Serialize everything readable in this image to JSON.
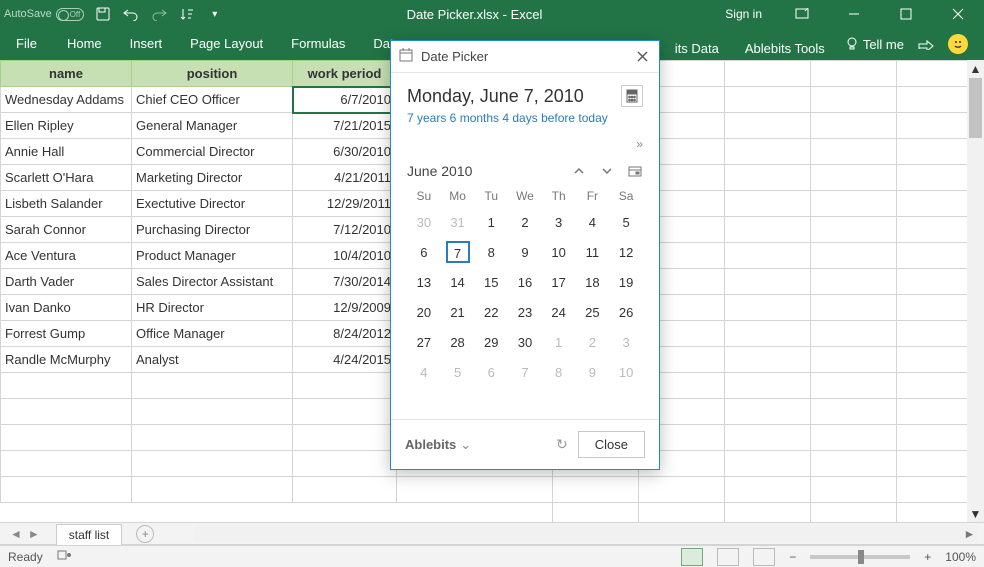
{
  "titlebar": {
    "autosave_label": "AutoSave",
    "autosave_off": "Off",
    "title": "Date Picker.xlsx - Excel",
    "signin": "Sign in"
  },
  "ribbon": {
    "file": "File",
    "tabs": [
      "Home",
      "Insert",
      "Page Layout",
      "Formulas",
      "Data"
    ],
    "right_partial": "its Data",
    "ablebits_tools": "Ablebits Tools",
    "tellme": "Tell me"
  },
  "sheet": {
    "headers": {
      "name": "name",
      "position": "position",
      "period": "work period"
    },
    "rows": [
      {
        "name": "Wednesday Addams",
        "position": "Chief CEO Officer",
        "period": "6/7/2010"
      },
      {
        "name": "Ellen Ripley",
        "position": "General Manager",
        "period": "7/21/2015"
      },
      {
        "name": "Annie Hall",
        "position": "Commercial Director",
        "period": "6/30/2010"
      },
      {
        "name": "Scarlett O'Hara",
        "position": "Marketing Director",
        "period": "4/21/2011"
      },
      {
        "name": "Lisbeth Salander",
        "position": "Exectutive Director",
        "period": "12/29/2011"
      },
      {
        "name": "Sarah Connor",
        "position": "Purchasing Director",
        "period": "7/12/2010"
      },
      {
        "name": "Ace Ventura",
        "position": "Product Manager",
        "period": "10/4/2010"
      },
      {
        "name": "Darth Vader",
        "position": "Sales Director Assistant",
        "period": "7/30/2014"
      },
      {
        "name": "Ivan Danko",
        "position": "HR Director",
        "period": "12/9/2009"
      },
      {
        "name": "Forrest Gump",
        "position": "Office Manager",
        "period": "8/24/2012"
      },
      {
        "name": "Randle McMurphy",
        "position": "Analyst",
        "period": "4/24/2015"
      }
    ],
    "selected_row": 0,
    "tab_name": "staff list"
  },
  "datepicker": {
    "pane_title": "Date Picker",
    "dateline": "Monday, June 7, 2010",
    "relative": "7 years 6 months 4 days before today",
    "month_label": "June 2010",
    "dow": [
      "Su",
      "Mo",
      "Tu",
      "We",
      "Th",
      "Fr",
      "Sa"
    ],
    "weeks": [
      [
        {
          "d": "30",
          "m": true
        },
        {
          "d": "31",
          "m": true
        },
        {
          "d": "1"
        },
        {
          "d": "2"
        },
        {
          "d": "3"
        },
        {
          "d": "4"
        },
        {
          "d": "5"
        }
      ],
      [
        {
          "d": "6"
        },
        {
          "d": "7",
          "sel": true
        },
        {
          "d": "8"
        },
        {
          "d": "9"
        },
        {
          "d": "10"
        },
        {
          "d": "11"
        },
        {
          "d": "12"
        }
      ],
      [
        {
          "d": "13"
        },
        {
          "d": "14"
        },
        {
          "d": "15"
        },
        {
          "d": "16"
        },
        {
          "d": "17"
        },
        {
          "d": "18"
        },
        {
          "d": "19"
        }
      ],
      [
        {
          "d": "20"
        },
        {
          "d": "21"
        },
        {
          "d": "22"
        },
        {
          "d": "23"
        },
        {
          "d": "24"
        },
        {
          "d": "25"
        },
        {
          "d": "26"
        }
      ],
      [
        {
          "d": "27"
        },
        {
          "d": "28"
        },
        {
          "d": "29"
        },
        {
          "d": "30"
        },
        {
          "d": "1",
          "m": true
        },
        {
          "d": "2",
          "m": true
        },
        {
          "d": "3",
          "m": true
        }
      ],
      [
        {
          "d": "4",
          "m": true
        },
        {
          "d": "5",
          "m": true
        },
        {
          "d": "6",
          "m": true
        },
        {
          "d": "7",
          "m": true
        },
        {
          "d": "8",
          "m": true
        },
        {
          "d": "9",
          "m": true
        },
        {
          "d": "10",
          "m": true
        }
      ]
    ],
    "brand": "Ablebits",
    "close": "Close"
  },
  "statusbar": {
    "ready": "Ready",
    "zoom": "100%"
  }
}
